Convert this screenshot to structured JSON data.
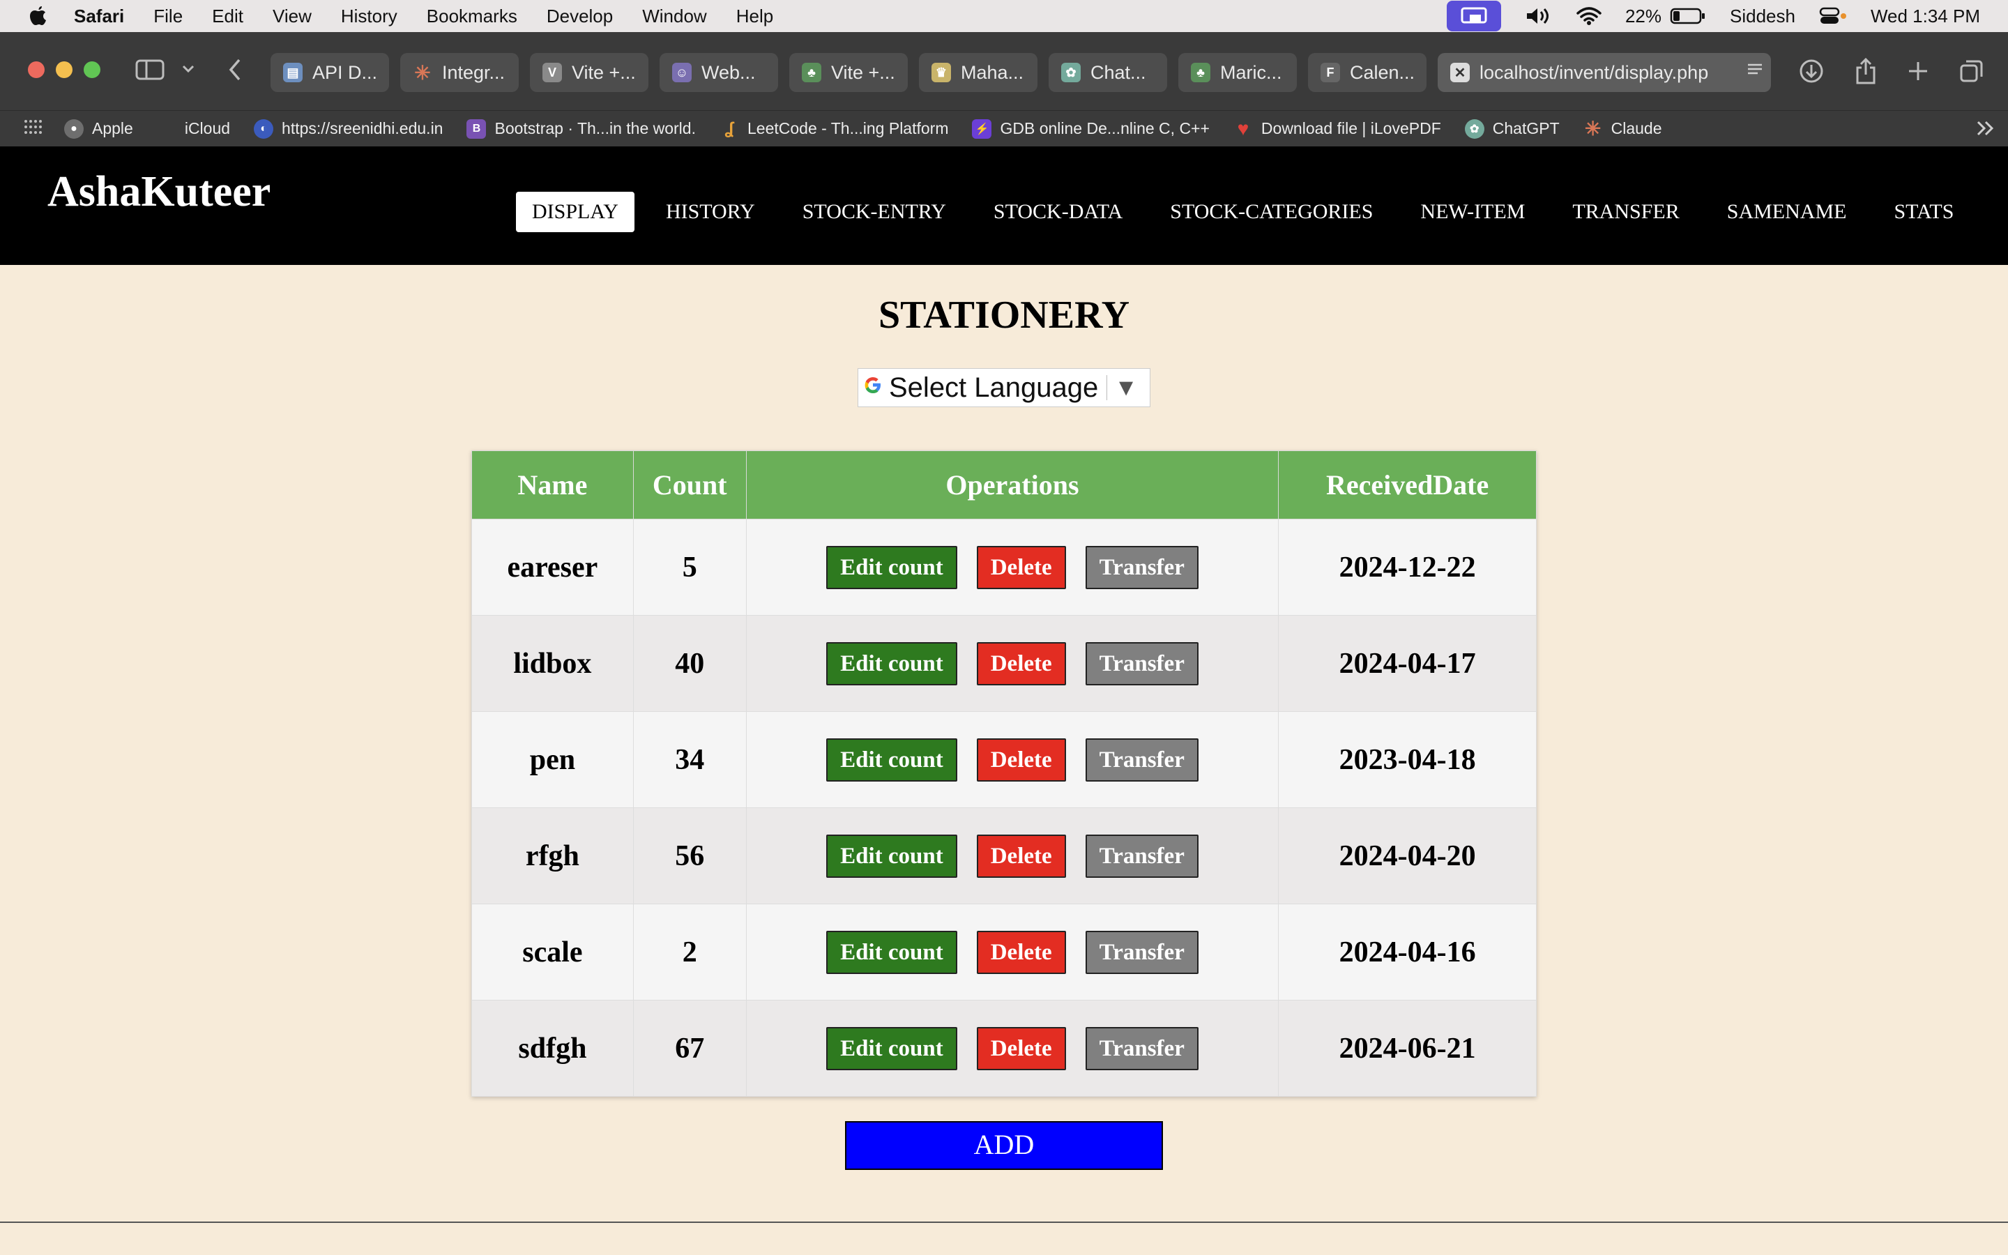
{
  "menubar": {
    "app": "Safari",
    "items": [
      "File",
      "Edit",
      "View",
      "History",
      "Bookmarks",
      "Develop",
      "Window",
      "Help"
    ],
    "battery": "22%",
    "user": "Siddesh",
    "clock": "Wed 1:34 PM"
  },
  "tabs": [
    {
      "label": "API D...",
      "icon": "document-icon",
      "color": "#6d8fbf"
    },
    {
      "label": "Integr...",
      "icon": "claude-icon",
      "color": "#d97757"
    },
    {
      "label": "Vite +...",
      "icon": "vite-icon",
      "color": "#8a8a8a",
      "letter": "V"
    },
    {
      "label": "Web...",
      "icon": "people-icon",
      "color": "#7a6fb0"
    },
    {
      "label": "Vite +...",
      "icon": "tree-icon",
      "color": "#5a8f5a"
    },
    {
      "label": "Maha...",
      "icon": "emblem-icon",
      "color": "#c9b46a"
    },
    {
      "label": "Chat...",
      "icon": "chatgpt-icon",
      "color": "#74aa9c"
    },
    {
      "label": "Maric...",
      "icon": "tree-icon",
      "color": "#5a8f5a"
    },
    {
      "label": "Calen...",
      "icon": "f-icon",
      "color": "#666",
      "letter": "F"
    },
    {
      "label": "localhost/invent/display.php",
      "icon": "close-icon",
      "color": "#ddd",
      "active": true
    }
  ],
  "bookmarks": [
    {
      "label": "Apple",
      "icon": "apple-icon",
      "color": "#777"
    },
    {
      "label": "iCloud",
      "icon": "apple-icon",
      "color": "#777"
    },
    {
      "label": "https://sreenidhi.edu.in",
      "icon": "globe-icon",
      "color": "#3b5bbd"
    },
    {
      "label": "Bootstrap · Th...in the world.",
      "icon": "bootstrap-icon",
      "color": "#7952b3",
      "letter": "B"
    },
    {
      "label": "LeetCode - Th...ing Platform",
      "icon": "leetcode-icon",
      "color": "#e8a33a"
    },
    {
      "label": "GDB online De...nline C, C++",
      "icon": "bolt-icon",
      "color": "#6b3fd6"
    },
    {
      "label": "Download file | iLovePDF",
      "icon": "heart-icon",
      "color": "#e0413a"
    },
    {
      "label": "ChatGPT",
      "icon": "chatgpt-icon",
      "color": "#74aa9c"
    },
    {
      "label": "Claude",
      "icon": "claude-icon",
      "color": "#d97757"
    }
  ],
  "site": {
    "brand": "AshaKuteer",
    "nav": [
      "DISPLAY",
      "HISTORY",
      "STOCK-ENTRY",
      "STOCK-DATA",
      "STOCK-CATEGORIES",
      "NEW-ITEM",
      "TRANSFER",
      "SAMENAME",
      "STATS"
    ],
    "active_nav": "DISPLAY"
  },
  "page": {
    "title": "STATIONERY",
    "language_select": "Select Language",
    "columns": [
      "Name",
      "Count",
      "Operations",
      "ReceivedDate"
    ],
    "rows": [
      {
        "name": "eareser",
        "count": "5",
        "date": "2024-12-22"
      },
      {
        "name": "lidbox",
        "count": "40",
        "date": "2024-04-17"
      },
      {
        "name": "pen",
        "count": "34",
        "date": "2023-04-18"
      },
      {
        "name": "rfgh",
        "count": "56",
        "date": "2024-04-20"
      },
      {
        "name": "scale",
        "count": "2",
        "date": "2024-04-16"
      },
      {
        "name": "sdfgh",
        "count": "67",
        "date": "2024-06-21"
      }
    ],
    "buttons": {
      "edit": "Edit count",
      "delete": "Delete",
      "transfer": "Transfer"
    },
    "add_label": "ADD"
  },
  "colors": {
    "header_green": "#6aaf58",
    "edit_green": "#2e7a1f",
    "delete_red": "#e32d22",
    "transfer_gray": "#808080",
    "add_blue": "#0000ff",
    "page_bg": "#f7ebd9"
  }
}
